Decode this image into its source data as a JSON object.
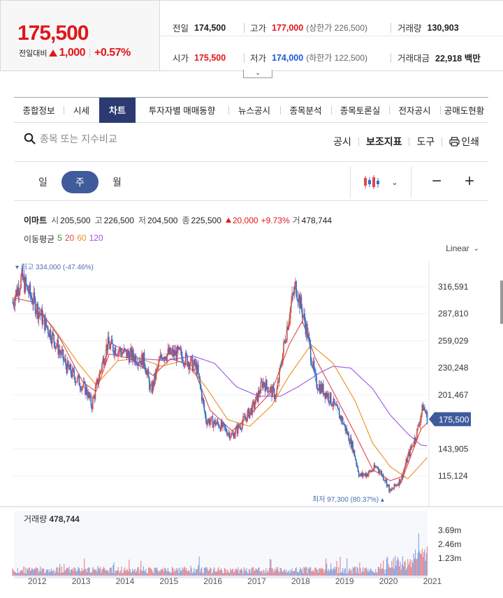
{
  "quote": {
    "price": "175,500",
    "change_label": "전일대비",
    "change_value": "1,000",
    "change_pct": "+0.57%",
    "prev_close_label": "전일",
    "prev_close": "174,500",
    "high_label": "고가",
    "high": "177,000",
    "upper_limit": "(상한가 226,500)",
    "volume_label": "거래량",
    "volume": "130,903",
    "open_label": "시가",
    "open": "175,500",
    "low_label": "저가",
    "low": "174,000",
    "lower_limit": "(하한가 122,500)",
    "amount_label": "거래대금",
    "amount": "22,918 백만"
  },
  "tabs": [
    {
      "label": "종합정보",
      "w": 0
    },
    {
      "label": "시세"
    },
    {
      "label": "차트",
      "active": true
    },
    {
      "label": "투자자별 매매동향"
    },
    {
      "label": "뉴스공시"
    },
    {
      "label": "종목분석"
    },
    {
      "label": "종목토론실"
    },
    {
      "label": "전자공시"
    },
    {
      "label": "공매도현황"
    }
  ],
  "search": {
    "placeholder": "종목 또는 지수비교"
  },
  "tools": {
    "disclosure": "공시",
    "indicator": "보조지표",
    "draw": "도구",
    "print": "인쇄"
  },
  "period": {
    "day": "일",
    "week": "주",
    "month": "월"
  },
  "info": {
    "name": "이마트",
    "open_k": "시",
    "open": "205,500",
    "high_k": "고",
    "high": "226,500",
    "low_k": "저",
    "low": "204,500",
    "close_k": "종",
    "close": "225,500",
    "change": "20,000",
    "pct": "+9.73%",
    "vol_k": "거",
    "vol": "478,744"
  },
  "ma": {
    "label": "이동평균",
    "p5": "5",
    "p20": "20",
    "p60": "60",
    "p120": "120",
    "colors": {
      "p5": "#1e9e3a",
      "p20": "#e0464c",
      "p60": "#f08c1e",
      "p120": "#9c55e0"
    }
  },
  "scale": "Linear",
  "chart_data": {
    "type": "candlestick",
    "y_ticks": [
      316591,
      287810,
      259029,
      230248,
      201467,
      143905,
      115124
    ],
    "y_tick_labels": [
      "316,591",
      "287,810",
      "259,029",
      "230,248",
      "201,467",
      "143,905",
      "115,124"
    ],
    "current_price": 175500,
    "current_label": "175,500",
    "max_label": "최고 334,000 (-47.46%)",
    "min_label": "최저 97,300 (80.37%)",
    "x_labels": [
      "2012",
      "2013",
      "2014",
      "2015",
      "2016",
      "2017",
      "2018",
      "2019",
      "2020",
      "2021"
    ],
    "close_path": [
      [
        2011.7,
        300000
      ],
      [
        2011.9,
        326000
      ],
      [
        2012.3,
        290000
      ],
      [
        2012.7,
        255000
      ],
      [
        2012.95,
        230000
      ],
      [
        2013.4,
        205000
      ],
      [
        2013.5,
        190000
      ],
      [
        2013.85,
        255000
      ],
      [
        2014.3,
        245000
      ],
      [
        2014.7,
        238000
      ],
      [
        2014.85,
        205000
      ],
      [
        2015.1,
        245000
      ],
      [
        2015.5,
        245000
      ],
      [
        2015.9,
        230000
      ],
      [
        2016.1,
        175000
      ],
      [
        2016.4,
        170000
      ],
      [
        2016.7,
        158000
      ],
      [
        2016.9,
        170000
      ],
      [
        2017.2,
        190000
      ],
      [
        2017.4,
        215000
      ],
      [
        2017.7,
        200000
      ],
      [
        2017.9,
        260000
      ],
      [
        2018.05,
        300000
      ],
      [
        2018.15,
        318000
      ],
      [
        2018.4,
        270000
      ],
      [
        2018.6,
        215000
      ],
      [
        2018.9,
        200000
      ],
      [
        2019.2,
        175000
      ],
      [
        2019.45,
        145000
      ],
      [
        2019.6,
        115000
      ],
      [
        2019.8,
        118000
      ],
      [
        2020.0,
        125000
      ],
      [
        2020.2,
        110000
      ],
      [
        2020.3,
        98000
      ],
      [
        2020.55,
        112000
      ],
      [
        2020.7,
        135000
      ],
      [
        2020.9,
        160000
      ],
      [
        2021.05,
        190000
      ],
      [
        2021.15,
        175500
      ]
    ],
    "ma20_path": [
      [
        2011.7,
        305000
      ],
      [
        2012.2,
        300000
      ],
      [
        2012.8,
        260000
      ],
      [
        2013.3,
        215000
      ],
      [
        2013.6,
        205000
      ],
      [
        2013.9,
        245000
      ],
      [
        2014.4,
        240000
      ],
      [
        2014.9,
        222000
      ],
      [
        2015.3,
        240000
      ],
      [
        2015.8,
        232000
      ],
      [
        2016.2,
        185000
      ],
      [
        2016.7,
        163000
      ],
      [
        2017.1,
        180000
      ],
      [
        2017.6,
        205000
      ],
      [
        2018.0,
        255000
      ],
      [
        2018.3,
        280000
      ],
      [
        2018.6,
        240000
      ],
      [
        2019.0,
        205000
      ],
      [
        2019.5,
        160000
      ],
      [
        2019.9,
        122000
      ],
      [
        2020.3,
        110000
      ],
      [
        2020.6,
        115000
      ],
      [
        2021.0,
        165000
      ],
      [
        2021.15,
        172000
      ]
    ],
    "ma60_path": [
      [
        2012.2,
        295000
      ],
      [
        2012.6,
        275000
      ],
      [
        2013.2,
        235000
      ],
      [
        2013.6,
        212000
      ],
      [
        2014.1,
        238000
      ],
      [
        2014.6,
        240000
      ],
      [
        2015.1,
        232000
      ],
      [
        2015.6,
        238000
      ],
      [
        2016.1,
        210000
      ],
      [
        2016.6,
        175000
      ],
      [
        2017.1,
        168000
      ],
      [
        2017.6,
        190000
      ],
      [
        2018.0,
        222000
      ],
      [
        2018.5,
        255000
      ],
      [
        2019.0,
        235000
      ],
      [
        2019.5,
        195000
      ],
      [
        2019.9,
        150000
      ],
      [
        2020.3,
        125000
      ],
      [
        2020.7,
        112000
      ],
      [
        2021.15,
        135000
      ]
    ],
    "ma120_path": [
      [
        2014.0,
        255000
      ],
      [
        2014.6,
        240000
      ],
      [
        2015.2,
        238000
      ],
      [
        2015.8,
        243000
      ],
      [
        2016.3,
        235000
      ],
      [
        2016.8,
        210000
      ],
      [
        2017.3,
        200000
      ],
      [
        2017.8,
        200000
      ],
      [
        2018.2,
        210000
      ],
      [
        2018.7,
        225000
      ],
      [
        2019.0,
        232000
      ],
      [
        2019.4,
        230000
      ],
      [
        2019.9,
        208000
      ],
      [
        2020.3,
        180000
      ],
      [
        2020.7,
        160000
      ],
      [
        2021.0,
        148000
      ],
      [
        2021.15,
        147000
      ]
    ],
    "volume": {
      "label": "거래량",
      "value": "478,744",
      "ticks": [
        "3.69m",
        "2.46m",
        "1.23m"
      ]
    }
  }
}
